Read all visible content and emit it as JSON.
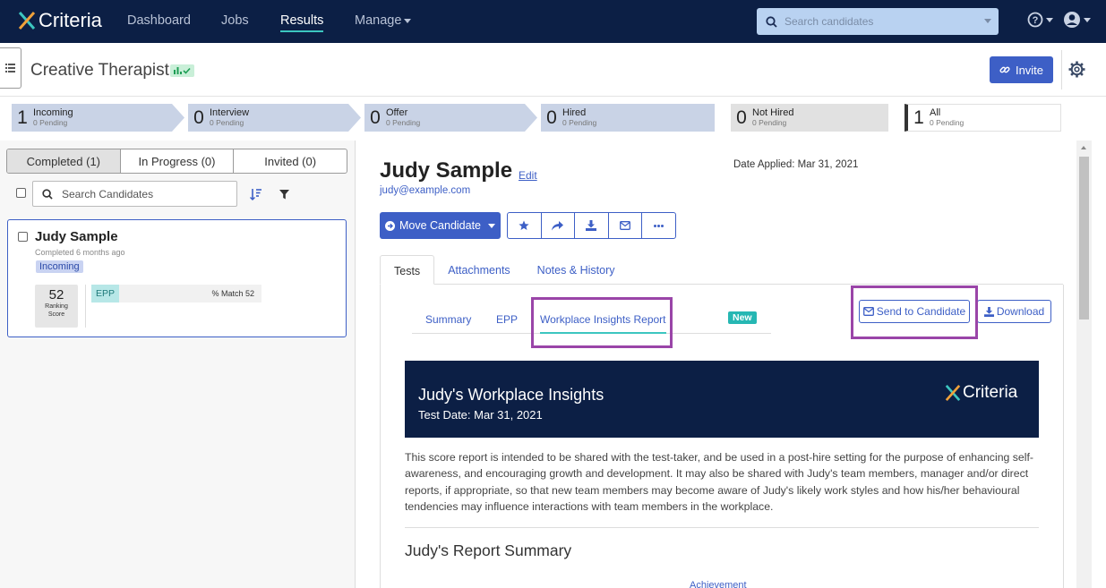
{
  "brand": {
    "name": "Criteria"
  },
  "nav": {
    "items": [
      {
        "label": "Dashboard"
      },
      {
        "label": "Jobs"
      },
      {
        "label": "Results"
      },
      {
        "label": "Manage"
      }
    ],
    "active": "Results",
    "search_placeholder": "Search candidates"
  },
  "job": {
    "title": "Creative Therapist",
    "invite_label": "Invite"
  },
  "pipeline": [
    {
      "count": "1",
      "label": "Incoming",
      "pending": "0 Pending"
    },
    {
      "count": "0",
      "label": "Interview",
      "pending": "0 Pending"
    },
    {
      "count": "0",
      "label": "Offer",
      "pending": "0 Pending"
    },
    {
      "count": "0",
      "label": "Hired",
      "pending": "0 Pending"
    },
    {
      "count": "0",
      "label": "Not Hired",
      "pending": "0 Pending"
    },
    {
      "count": "1",
      "label": "All",
      "pending": "0 Pending"
    }
  ],
  "left": {
    "tabs": [
      {
        "label": "Completed (1)"
      },
      {
        "label": "In Progress (0)"
      },
      {
        "label": "Invited (0)"
      }
    ],
    "search_placeholder": "Search Candidates",
    "candidate": {
      "name": "Judy Sample",
      "status_line": "Completed 6 months ago",
      "stage_badge": "Incoming",
      "score": "52",
      "score_label_1": "Ranking",
      "score_label_2": "Score",
      "test_badge": "EPP",
      "match_text": "% Match 52"
    }
  },
  "detail": {
    "name": "Judy Sample",
    "edit_label": "Edit",
    "email": "judy@example.com",
    "date_applied": "Date Applied: Mar 31, 2021",
    "move_label": "Move Candidate",
    "tabs": [
      {
        "label": "Tests"
      },
      {
        "label": "Attachments"
      },
      {
        "label": "Notes & History"
      }
    ],
    "subtabs": [
      {
        "label": "Summary"
      },
      {
        "label": "EPP"
      },
      {
        "label": "Workplace Insights Report"
      }
    ],
    "new_badge": "New",
    "send_label": "Send to Candidate",
    "download_label": "Download",
    "report": {
      "title": "Judy's Workplace Insights",
      "test_date": "Test Date: Mar 31, 2021",
      "paragraph": "This score report is intended to be shared with the test-taker, and be used in a post-hire setting for the purpose of enhancing self-awareness, and encouraging growth and development. It may also be shared with Judy's team members, manager and/or direct reports, if appropriate, so that new team members may become aware of Judy's likely work styles and how his/her behavioural tendencies may influence interactions with team members in the workplace.",
      "summary_heading": "Judy's Report Summary",
      "achievement_label": "Achievement"
    }
  },
  "colors": {
    "navy": "#0c1f45",
    "accent_blue": "#3d5fc6",
    "teal": "#26b7b3",
    "highlight_purple": "#9a45a8"
  }
}
